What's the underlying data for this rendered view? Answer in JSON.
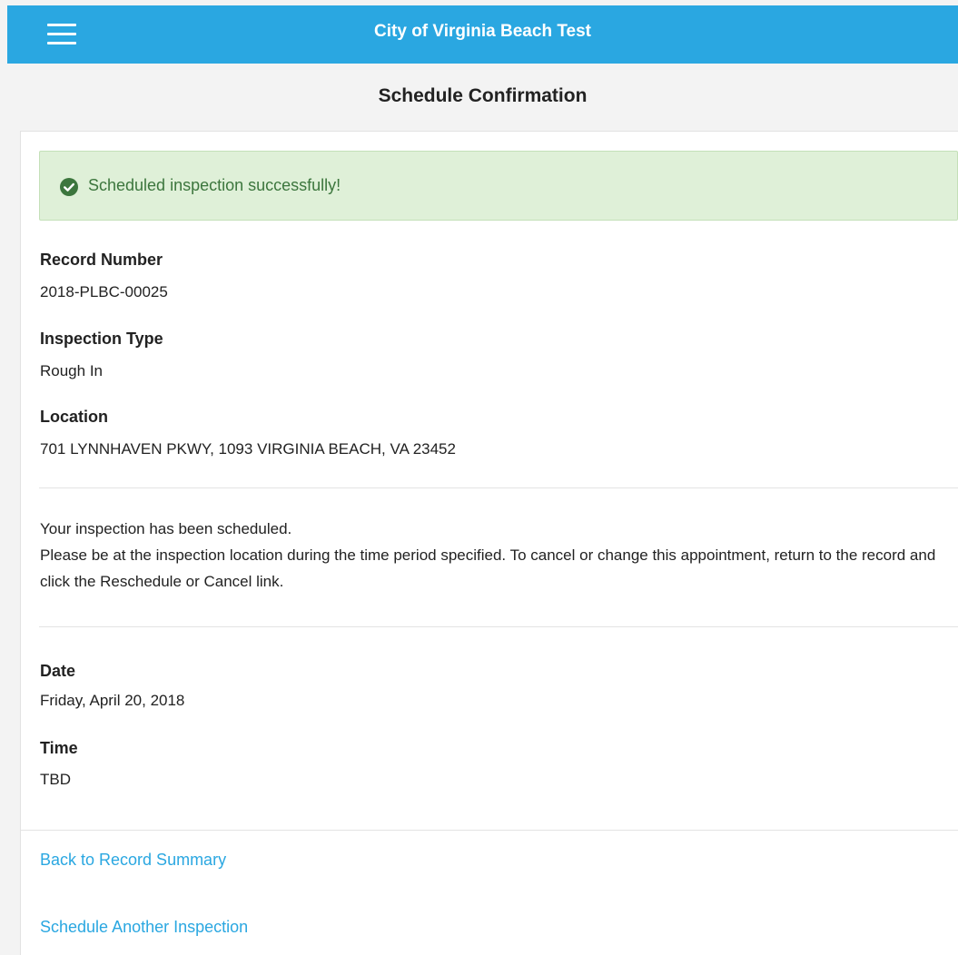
{
  "header": {
    "app_title": "City of Virginia Beach Test",
    "menu_icon": "hamburger-menu-icon",
    "background_color": "#2aa7e1"
  },
  "page": {
    "title": "Schedule Confirmation"
  },
  "alert": {
    "icon": "check-circle-icon",
    "message": "Scheduled inspection successfully!",
    "background_color": "#dff0d8",
    "text_color": "#3c763d"
  },
  "record": {
    "record_number_label": "Record Number",
    "record_number": "2018-PLBC-00025",
    "inspection_type_label": "Inspection Type",
    "inspection_type": "Rough In",
    "location_label": "Location",
    "location": "701 LYNNHAVEN PKWY, 1093 VIRGINIA BEACH, VA 23452"
  },
  "message": {
    "line1": "Your inspection has been scheduled.",
    "line2": "Please be at the inspection location during the time period specified. To cancel or change this appointment, return to the record and click the Reschedule or Cancel link."
  },
  "schedule": {
    "date_label": "Date",
    "date": "Friday, April 20, 2018",
    "time_label": "Time",
    "time": "TBD"
  },
  "links": {
    "back_to_summary": "Back to Record Summary",
    "schedule_another": "Schedule Another Inspection",
    "link_color": "#2aa7e1"
  }
}
